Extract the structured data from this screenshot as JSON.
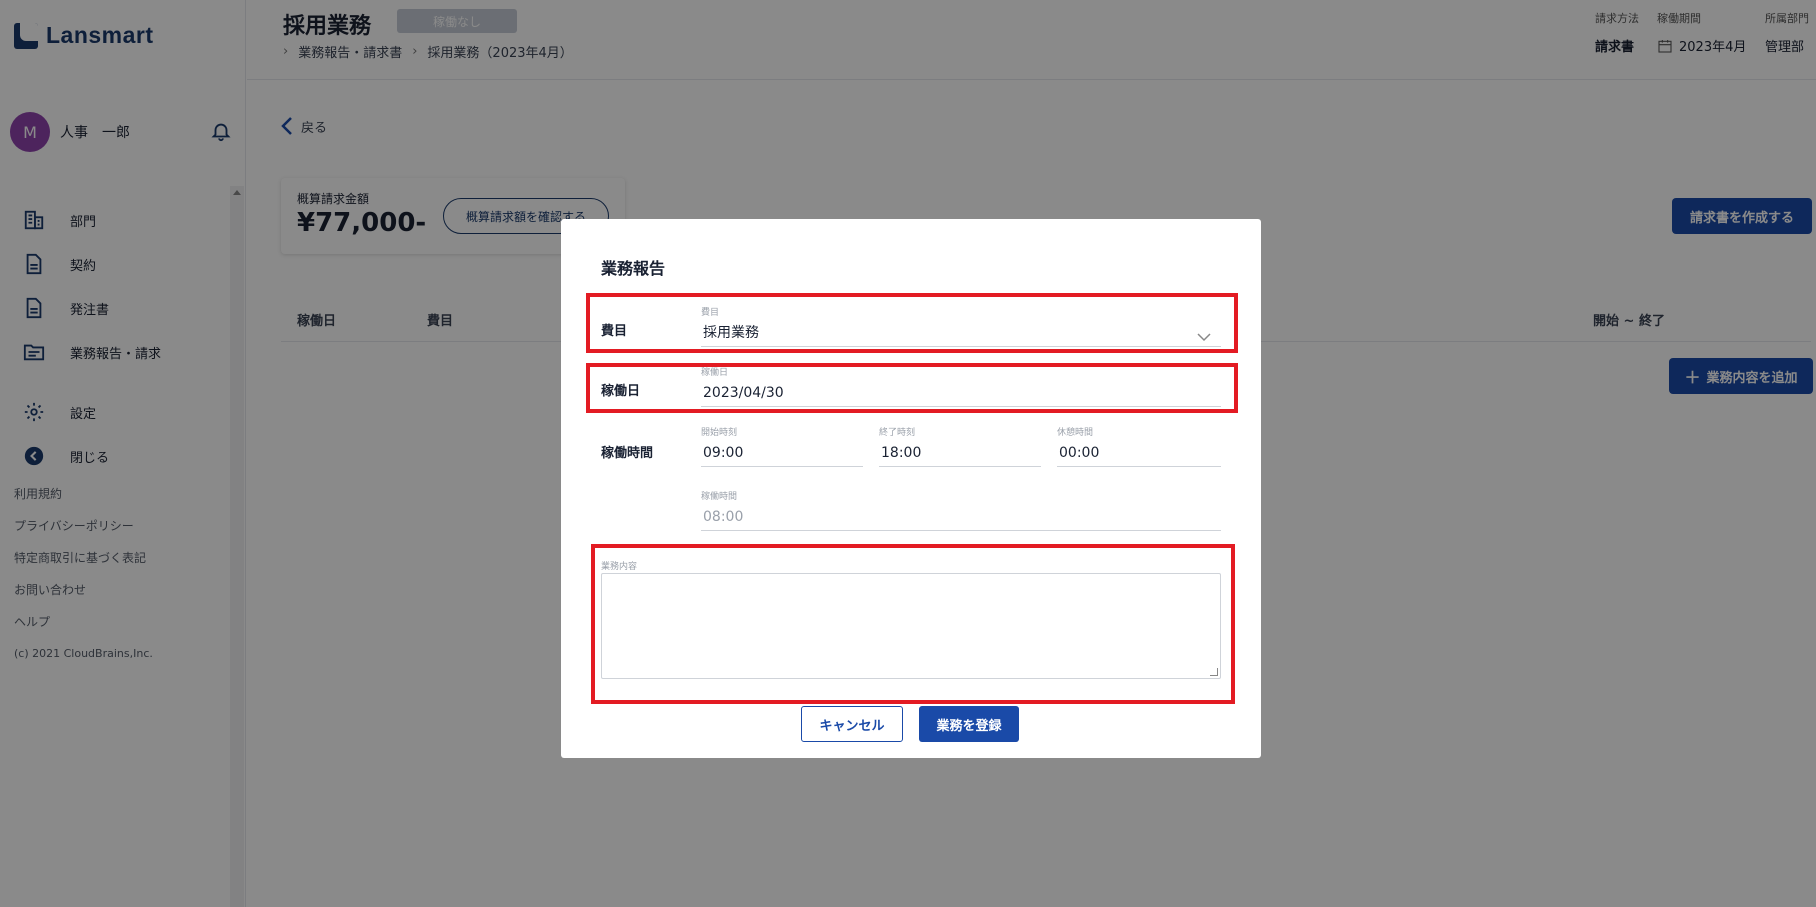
{
  "app": {
    "logo_text": "Lansmart"
  },
  "user": {
    "avatar_initial": "M",
    "name": "人事　一郎"
  },
  "sidebar": {
    "items": [
      {
        "label": "部門",
        "icon": "building-icon"
      },
      {
        "label": "契約",
        "icon": "document-icon"
      },
      {
        "label": "発注書",
        "icon": "document-icon"
      },
      {
        "label": "業務報告・請求",
        "icon": "folder-icon"
      },
      {
        "label": "設定",
        "icon": "gear-icon"
      },
      {
        "label": "閉じる",
        "icon": "arrow-left-circle-icon"
      }
    ],
    "links": [
      "利用規約",
      "プライバシーポリシー",
      "特定商取引に基づく表記",
      "お問い合わせ",
      "ヘルプ"
    ],
    "copyright": "(c) 2021 CloudBrains,Inc."
  },
  "header": {
    "title": "採用業務",
    "status_badge": "稼働なし",
    "breadcrumb": [
      "業務報告・請求書",
      "採用業務（2023年4月）"
    ],
    "meta": {
      "billing_method_label": "請求方法",
      "billing_method_value": "請求書",
      "period_label": "稼働期間",
      "period_value": "2023年4月",
      "department_label": "所属部門",
      "department_value": "管理部"
    }
  },
  "main": {
    "back_label": "戻る",
    "estimate": {
      "label": "概算請求金額",
      "amount": "¥77,000-",
      "confirm_button": "概算請求額を確認する"
    },
    "create_invoice_button": "請求書を作成する",
    "table_headers": [
      "稼働日",
      "費目",
      "開始 ~ 終了"
    ],
    "add_work_button": "業務内容を追加"
  },
  "modal": {
    "title": "業務報告",
    "expense": {
      "row_label": "費目",
      "field_label": "費目",
      "value": "採用業務"
    },
    "work_date": {
      "row_label": "稼働日",
      "field_label": "稼働日",
      "value": "2023/04/30"
    },
    "work_time": {
      "row_label": "稼働時間",
      "start_label": "開始時刻",
      "start_value": "09:00",
      "end_label": "終了時刻",
      "end_value": "18:00",
      "break_label": "休憩時間",
      "break_value": "00:00",
      "total_label": "稼働時間",
      "total_value": "08:00"
    },
    "content": {
      "field_label": "業務内容",
      "value": ""
    },
    "cancel_button": "キャンセル",
    "submit_button": "業務を登録"
  },
  "colors": {
    "primary": "#1a4aa8",
    "brand": "#1a3a6b",
    "highlight": "#e31b23",
    "avatar": "#8e44ad"
  }
}
